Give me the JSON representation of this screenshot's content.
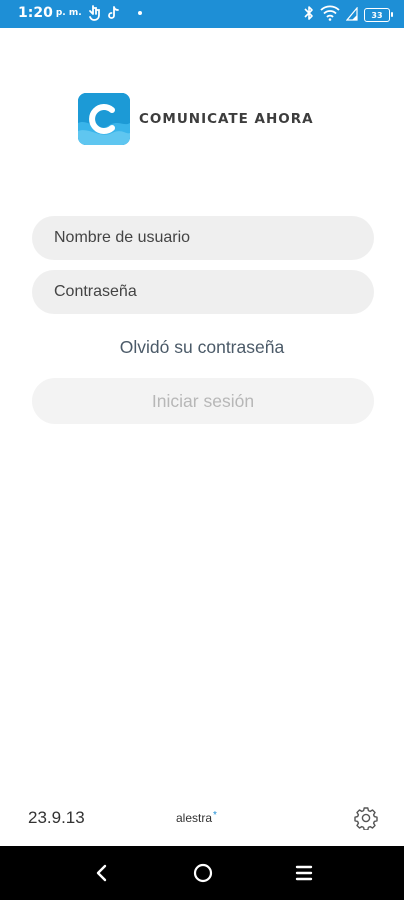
{
  "status_bar": {
    "time": "1:20",
    "am_pm": "p. m.",
    "battery": "33"
  },
  "logo": {
    "letter": "C",
    "name": "COMUNICATE AHORA"
  },
  "login_form": {
    "username_placeholder": "Nombre de usuario",
    "password_placeholder": "Contraseña",
    "forgot_password": "Olvidó su contraseña",
    "login_button": "Iniciar sesión"
  },
  "footer": {
    "version": "23.9.13",
    "brand": "alestra",
    "brand_mark": "*"
  },
  "icons": [
    "hand-gesture-icon",
    "tiktok-icon",
    "notification-dot-icon",
    "bluetooth-icon",
    "wifi-icon",
    "signal-icon",
    "battery-icon",
    "settings-gear-icon",
    "back-icon",
    "home-icon",
    "recent-apps-icon"
  ],
  "colors": {
    "status_bar": "#1e8fd6",
    "logo_blue": "#1c9ad6",
    "field_bg": "#efefef",
    "button_bg": "#f3f3f3",
    "button_text_disabled": "#b7b7b7"
  }
}
